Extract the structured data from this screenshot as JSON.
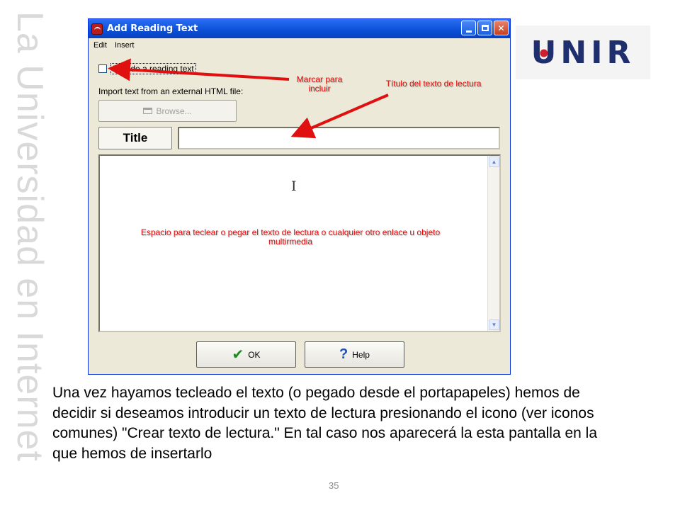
{
  "watermark": "La Universidad en Internet",
  "logo": {
    "text": "UNIR",
    "dot_color": "#cf1f2e",
    "text_color": "#1f2f6d"
  },
  "dialog": {
    "title": "Add Reading Text",
    "titlebar_buttons": [
      "minimize",
      "maximize",
      "close"
    ],
    "menu": [
      "Edit",
      "Insert"
    ],
    "checkbox_label": "Include a reading text",
    "checkbox_checked": false,
    "import_label": "Import text from an external HTML file:",
    "browse_label": "Browse...",
    "browse_enabled": false,
    "title_button_label": "Title",
    "title_input_value": "",
    "text_area_value": "",
    "ok_label": "OK",
    "help_label": "Help"
  },
  "annotations": {
    "marcar": "Marcar para incluir",
    "titulo": "Título del texto de lectura",
    "espacio": "Espacio para teclear o pegar el texto de lectura o cualquier otro enlace u objeto multirmedia",
    "color": "#e01010"
  },
  "body_text": "Una vez hayamos tecleado el texto (o pegado desde el portapapeles) hemos de decidir si deseamos introducir un texto de lectura presionando el icono (ver iconos comunes)  \"Crear texto de lectura.\" En tal caso nos aparecerá la esta pantalla en la que hemos de insertarlo",
  "page_number": "35"
}
